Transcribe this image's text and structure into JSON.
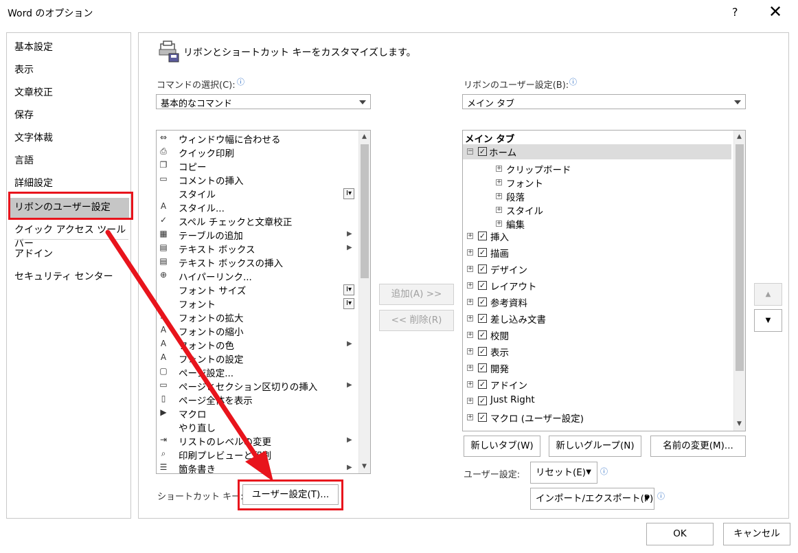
{
  "window": {
    "title": "Word のオプション",
    "help": "?",
    "close": "✕"
  },
  "nav": {
    "items": [
      "基本設定",
      "表示",
      "文章校正",
      "保存",
      "文字体裁",
      "言語",
      "詳細設定",
      "リボンのユーザー設定",
      "クイック アクセス ツール バー",
      "アドイン",
      "セキュリティ センター"
    ]
  },
  "main": {
    "heading": "リボンとショートカット キーをカスタマイズします。",
    "commands_label": "コマンドの選択(C):",
    "commands_select": "基本的なコマンド",
    "ribbon_label": "リボンのユーザー設定(B):",
    "ribbon_select": "メイン タブ",
    "commands": [
      {
        "label": "ウィンドウ幅に合わせる",
        "icon": "fit-width-icon",
        "glyph": "⇔"
      },
      {
        "label": "クイック印刷",
        "icon": "quick-print-icon",
        "glyph": "⎙"
      },
      {
        "label": "コピー",
        "icon": "copy-icon",
        "glyph": "❐"
      },
      {
        "label": "コメントの挿入",
        "icon": "comment-icon",
        "glyph": "▭"
      },
      {
        "label": "スタイル",
        "icon": "",
        "glyph": ""
      },
      {
        "label": "スタイル...",
        "icon": "styles-icon",
        "glyph": "A"
      },
      {
        "label": "スペル チェックと文章校正",
        "icon": "spelling-icon",
        "glyph": "✓"
      },
      {
        "label": "テーブルの追加",
        "icon": "table-icon",
        "glyph": "▦"
      },
      {
        "label": "テキスト ボックス",
        "icon": "textbox-icon",
        "glyph": "▤"
      },
      {
        "label": "テキスト ボックスの挿入",
        "icon": "textbox-insert-icon",
        "glyph": "▤"
      },
      {
        "label": "ハイパーリンク...",
        "icon": "hyperlink-icon",
        "glyph": "⊕"
      },
      {
        "label": "フォント サイズ",
        "icon": "",
        "glyph": ""
      },
      {
        "label": "フォント",
        "icon": "",
        "glyph": ""
      },
      {
        "label": "フォントの拡大",
        "icon": "font-grow-icon",
        "glyph": "A"
      },
      {
        "label": "フォントの縮小",
        "icon": "font-shrink-icon",
        "glyph": "A"
      },
      {
        "label": "フォントの色",
        "icon": "font-color-icon",
        "glyph": "A"
      },
      {
        "label": "フォントの設定",
        "icon": "font-settings-icon",
        "glyph": "A"
      },
      {
        "label": "ページ設定...",
        "icon": "page-setup-icon",
        "glyph": "▢"
      },
      {
        "label": "ページとセクション区切りの挿入",
        "icon": "page-break-icon",
        "glyph": "▭"
      },
      {
        "label": "ページ全体を表示",
        "icon": "full-page-icon",
        "glyph": "▯"
      },
      {
        "label": "マクロ",
        "icon": "macro-icon",
        "glyph": "▶"
      },
      {
        "label": "やり直し",
        "icon": "",
        "glyph": ""
      },
      {
        "label": "リストのレベルの変更",
        "icon": "list-level-icon",
        "glyph": "⇥"
      },
      {
        "label": "印刷プレビューと印刷",
        "icon": "print-preview-icon",
        "glyph": "⌕"
      },
      {
        "label": "箇条書き",
        "icon": "bullets-icon",
        "glyph": "☰"
      }
    ],
    "add_button": "追加(A) >>",
    "remove_button": "<< 削除(R)",
    "ribbon_tree": {
      "header": "メイン タブ",
      "home": "ホーム",
      "home_groups": [
        "クリップボード",
        "フォント",
        "段落",
        "スタイル",
        "編集"
      ],
      "tabs": [
        "挿入",
        "描画",
        "デザイン",
        "レイアウト",
        "参考資料",
        "差し込み文書",
        "校閲",
        "表示",
        "開発",
        "アドイン",
        "Just Right",
        "マクロ (ユーザー設定)"
      ]
    },
    "new_tab": "新しいタブ(W)",
    "new_group": "新しいグループ(N)",
    "rename": "名前の変更(M)...",
    "user_settings_label": "ユーザー設定:",
    "reset": "リセット(E)",
    "import_export": "インポート/エクスポート(P)",
    "shortcut_label": "ショートカット キー:",
    "shortcut_button": "ユーザー設定(T)..."
  },
  "footer": {
    "ok": "OK",
    "cancel": "キャンセル"
  },
  "colors": {
    "highlight": "#e8141c",
    "selection": "#c6c6c6"
  }
}
